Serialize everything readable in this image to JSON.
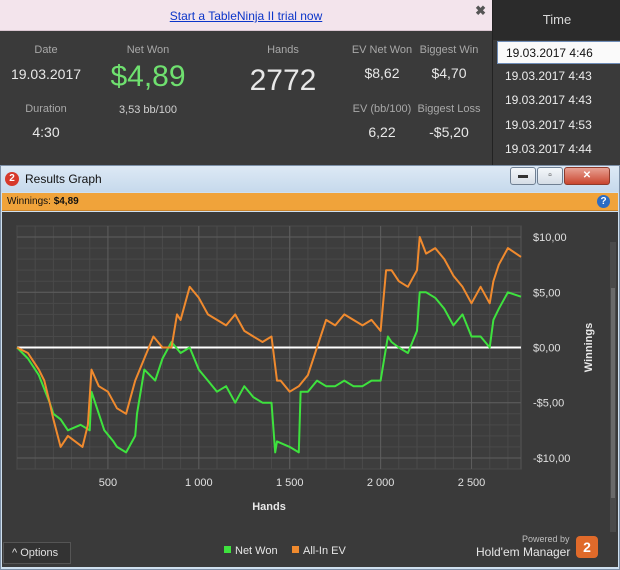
{
  "banner": {
    "link": "Start a TableNinja II trial now",
    "close": "✖"
  },
  "stats": {
    "date_label": "Date",
    "date": "19.03.2017",
    "duration_label": "Duration",
    "duration": "4:30",
    "net_won_label": "Net Won",
    "net_won": "$4,89",
    "bb_per_100": "3,53 bb/100",
    "hands_label": "Hands",
    "hands": "2772",
    "ev_net_won_label": "EV Net Won",
    "ev_net_won": "$8,62",
    "biggest_win_label": "Biggest Win",
    "biggest_win": "$4,70",
    "ev_bb_label": "EV (bb/100)",
    "ev_bb": "6,22",
    "biggest_loss_label": "Biggest Loss",
    "biggest_loss": "-$5,20"
  },
  "time_list": {
    "header": "Time",
    "rows": [
      "19.03.2017 4:46",
      "19.03.2017 4:43",
      "19.03.2017 4:43",
      "19.03.2017 4:53",
      "19.03.2017 4:44"
    ],
    "selected_index": 0
  },
  "window": {
    "title": "Results Graph",
    "logo_glyph": "2",
    "buttons": {
      "minimize": "▬",
      "maximize": "▫",
      "close": "✕"
    },
    "winnings_label": "Winnings:",
    "winnings_value": "$4,89",
    "help_glyph": "?"
  },
  "footer": {
    "options": "^ Options",
    "legend": [
      "Net Won",
      "All-In EV"
    ],
    "powered_by": "Powered by",
    "brand": "Hold'em Manager",
    "brand_logo_glyph": "2"
  },
  "colors": {
    "net_won": "#3ee23e",
    "all_in_ev": "#f08a2e",
    "zero_line": "#ffffff",
    "accent": "#f0a33a"
  },
  "chart_data": {
    "type": "line",
    "xlabel": "Hands",
    "ylabel": "Winnings",
    "xlim": [
      0,
      2772
    ],
    "ylim": [
      -11,
      11
    ],
    "x_ticks": [
      500,
      1000,
      1500,
      2000,
      2500
    ],
    "x_tick_labels": [
      "500",
      "1 000",
      "1 500",
      "2 000",
      "2 500"
    ],
    "y_ticks": [
      10,
      5,
      0,
      -5,
      -10
    ],
    "y_tick_labels": [
      "$10,00",
      "$5,00",
      "$0,00",
      "-$5,00",
      "-$10,00"
    ],
    "grid": true,
    "legend_position": "bottom-center",
    "series": [
      {
        "name": "Net Won",
        "x": [
          0,
          60,
          120,
          180,
          200,
          240,
          280,
          350,
          400,
          410,
          480,
          530,
          550,
          600,
          650,
          660,
          700,
          760,
          800,
          850,
          900,
          950,
          1000,
          1050,
          1100,
          1150,
          1200,
          1250,
          1300,
          1350,
          1400,
          1420,
          1430,
          1500,
          1550,
          1560,
          1600,
          1650,
          1700,
          1750,
          1800,
          1850,
          1900,
          1950,
          2000,
          2040,
          2060,
          2100,
          2150,
          2200,
          2215,
          2250,
          2300,
          2350,
          2400,
          2450,
          2500,
          2550,
          2600,
          2620,
          2650,
          2700,
          2772
        ],
        "values": [
          0,
          -1.0,
          -2.5,
          -5,
          -6,
          -6.5,
          -7.5,
          -7,
          -7.5,
          -4,
          -7.5,
          -8.5,
          -9,
          -9.5,
          -8,
          -6,
          -2,
          -3,
          -1,
          0.5,
          -0.5,
          0,
          -2,
          -3,
          -4,
          -3.5,
          -5,
          -3.5,
          -4.5,
          -5,
          -5,
          -9.5,
          -8.5,
          -9,
          -9.5,
          -4,
          -4,
          -3,
          -3.5,
          -3.5,
          -3,
          -3.5,
          -3.5,
          -3,
          -3,
          1,
          0.5,
          0,
          -0.5,
          1.5,
          5,
          5,
          4.5,
          3.5,
          2,
          3,
          1,
          1,
          0,
          2.5,
          3.5,
          5,
          4.6
        ]
      },
      {
        "name": "All-In EV",
        "x": [
          0,
          60,
          120,
          150,
          180,
          200,
          240,
          280,
          320,
          360,
          390,
          410,
          450,
          500,
          550,
          600,
          650,
          700,
          750,
          800,
          850,
          880,
          900,
          950,
          1000,
          1050,
          1100,
          1150,
          1200,
          1250,
          1300,
          1350,
          1400,
          1430,
          1450,
          1500,
          1550,
          1600,
          1650,
          1700,
          1750,
          1800,
          1850,
          1900,
          1950,
          2000,
          2030,
          2060,
          2100,
          2150,
          2200,
          2215,
          2250,
          2300,
          2350,
          2400,
          2450,
          2500,
          2550,
          2600,
          2620,
          2650,
          2700,
          2772
        ],
        "values": [
          0,
          -0.5,
          -2,
          -3,
          -5,
          -6.5,
          -9,
          -8,
          -8.5,
          -9,
          -7,
          -2,
          -3.5,
          -4,
          -5.5,
          -6,
          -3,
          -1,
          1,
          0,
          0,
          3,
          2.5,
          5.5,
          4.5,
          3,
          2.5,
          2.0,
          3,
          1.5,
          1,
          0.5,
          1,
          -3,
          -3,
          -4,
          -3.5,
          -2.5,
          0,
          2.5,
          2.0,
          3,
          2.5,
          2,
          2.5,
          1.5,
          7,
          7,
          6,
          5.5,
          7,
          10,
          8.5,
          9,
          8,
          6.5,
          5.5,
          4,
          5.5,
          4,
          6,
          7.5,
          9,
          8.2
        ]
      }
    ]
  }
}
